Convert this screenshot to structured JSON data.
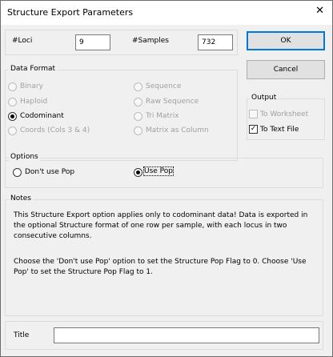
{
  "window": {
    "title": "Structure Export Parameters",
    "close_glyph": "✕"
  },
  "counts": {
    "loci_label": "#Loci",
    "loci_value": "9",
    "samples_label": "#Samples",
    "samples_value": "732"
  },
  "buttons": {
    "ok": "OK",
    "cancel": "Cancel"
  },
  "data_format": {
    "legend": "Data Format",
    "left": [
      {
        "label": "Binary",
        "enabled": false,
        "selected": false
      },
      {
        "label": "Haploid",
        "enabled": false,
        "selected": false
      },
      {
        "label": "Codominant",
        "enabled": true,
        "selected": true
      },
      {
        "label": "Coords (Cols 3 & 4)",
        "enabled": false,
        "selected": false
      }
    ],
    "right": [
      {
        "label": "Sequence",
        "enabled": false,
        "selected": false
      },
      {
        "label": "Raw Sequence",
        "enabled": false,
        "selected": false
      },
      {
        "label": "Tri Matrix",
        "enabled": false,
        "selected": false
      },
      {
        "label": "Matrix as Column",
        "enabled": false,
        "selected": false
      }
    ]
  },
  "output": {
    "legend": "Output",
    "to_worksheet": {
      "label": "To Worksheet",
      "checked": false,
      "enabled": false
    },
    "to_text_file": {
      "label": "To Text File",
      "checked": true,
      "enabled": true
    }
  },
  "options": {
    "legend": "Options",
    "dont_use_pop": {
      "label": "Don't use Pop",
      "selected": false
    },
    "use_pop": {
      "label": "Use Pop",
      "selected": true
    }
  },
  "notes": {
    "legend": "Notes",
    "paragraph1": "This Structure Export option applies only to codominant data!  Data is exported in the optional Structure format of one row per sample, with each locus in two consecutive columns.",
    "paragraph2": "Choose the 'Don't use Pop' option to set the Structure Pop Flag to 0. Choose 'Use Pop' to set the Structure Pop Flag to 1."
  },
  "title_field": {
    "label": "Title",
    "value": ""
  }
}
